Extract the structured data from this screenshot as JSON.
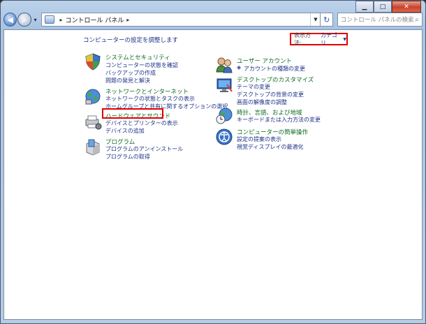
{
  "window": {
    "buttons": {
      "minimize": "▁",
      "maximize": "□",
      "close": "✕"
    }
  },
  "address_bar": {
    "breadcrumb": [
      "コントロール パネル"
    ],
    "search_placeholder": "コントロール パネルの検索"
  },
  "main": {
    "intro": "コンピューターの設定を調整します",
    "view_by_label": "表示方法:",
    "view_by_value": "カテゴリ"
  },
  "categories": {
    "system": {
      "title": "システムとセキュリティ",
      "links": [
        "コンピューターの状態を確認",
        "バックアップの作成",
        "問題の発見と解決"
      ]
    },
    "network": {
      "title": "ネットワークとインターネット",
      "links": [
        "ネットワークの状態とタスクの表示",
        "ホームグループと共有に関するオプションの選択"
      ]
    },
    "hardware": {
      "title": "ハードウェアとサウンド",
      "links": [
        "デバイスとプリンターの表示",
        "デバイスの追加"
      ]
    },
    "programs": {
      "title": "プログラム",
      "links": [
        "プログラムのアンインストール",
        "プログラムの取得"
      ]
    },
    "user_accounts": {
      "title": "ユーザー アカウント",
      "links": [
        "アカウントの種類の変更"
      ]
    },
    "appearance": {
      "title": "デスクトップのカスタマイズ",
      "links": [
        "テーマの変更",
        "デスクトップの背景の変更",
        "画面の解像度の調整"
      ]
    },
    "clock": {
      "title": "時計、言語、および地域",
      "links": [
        "キーボードまたは入力方法の変更"
      ]
    },
    "ease": {
      "title": "コンピューターの簡単操作",
      "links": [
        "設定の提案の表示",
        "視覚ディスプレイの最適化"
      ]
    }
  },
  "colors": {
    "category_title": "#0e6b24",
    "link": "#1e3287",
    "highlight": "#e00000"
  }
}
